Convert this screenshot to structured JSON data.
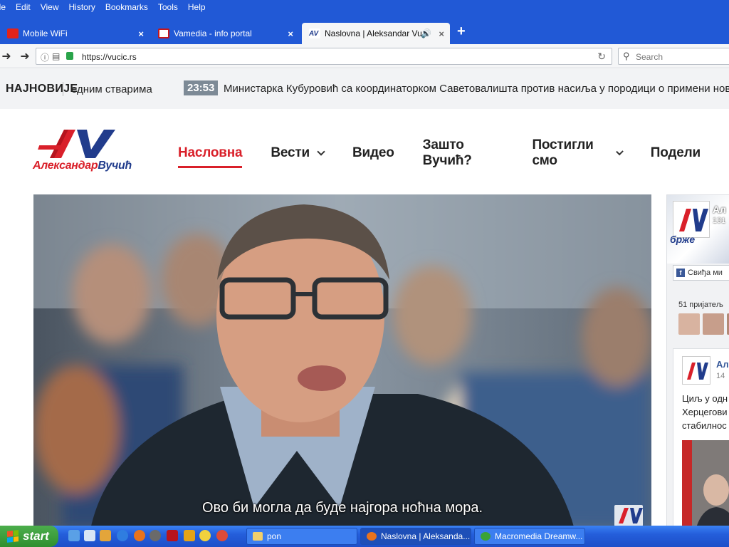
{
  "browser": {
    "menu": [
      "ile",
      "Edit",
      "View",
      "History",
      "Bookmarks",
      "Tools",
      "Help"
    ],
    "tabs": [
      {
        "title": "Mobile WiFi",
        "icon": "huawei-icon"
      },
      {
        "title": "Vamedia - info portal",
        "icon": "vamedia-icon"
      },
      {
        "title": "Naslovna | Aleksandar Vu...",
        "icon": "av-icon"
      }
    ],
    "url": "https://vucic.rs",
    "search_placeholder": "Search"
  },
  "ticker": {
    "label": "НАЈНОВИЈЕ",
    "previous_fragment": "едним стварима",
    "time": "23:53",
    "headline": "Министарка Кубуровић са координаторком Саветовалишта против насиља у породици о примени новог"
  },
  "logo": {
    "mark": "AV",
    "first": "Александар",
    "last": "Вучић"
  },
  "nav": [
    {
      "label": "Насловна",
      "active": true,
      "dropdown": false
    },
    {
      "label": "Вести",
      "active": false,
      "dropdown": true
    },
    {
      "label": "Видео",
      "active": false,
      "dropdown": false
    },
    {
      "label": "Зашто Вучић?",
      "active": false,
      "dropdown": false
    },
    {
      "label": "Постигли смо",
      "active": false,
      "dropdown": true
    },
    {
      "label": "Подели",
      "active": false,
      "dropdown": false
    }
  ],
  "video": {
    "caption": "Ово би могла да буде најгора ноћна мора."
  },
  "facebook_widget": {
    "page_name": "Ал",
    "followers": "131",
    "cover_text": "брже",
    "like_label": "Свиђа ми",
    "friends": "51 пријатељ",
    "post_name": "Ал",
    "post_date": "14 ",
    "post_text": [
      "Циљ у одн",
      "Херцегови",
      "стабилнос"
    ]
  },
  "taskbar": {
    "start": "start",
    "tasks": [
      {
        "label": "pon",
        "icon": "folder-icon"
      },
      {
        "label": "Naslovna | Aleksanda...",
        "icon": "firefox-icon"
      },
      {
        "label": "Macromedia Dreamw...",
        "icon": "dreamweaver-icon"
      }
    ]
  }
}
